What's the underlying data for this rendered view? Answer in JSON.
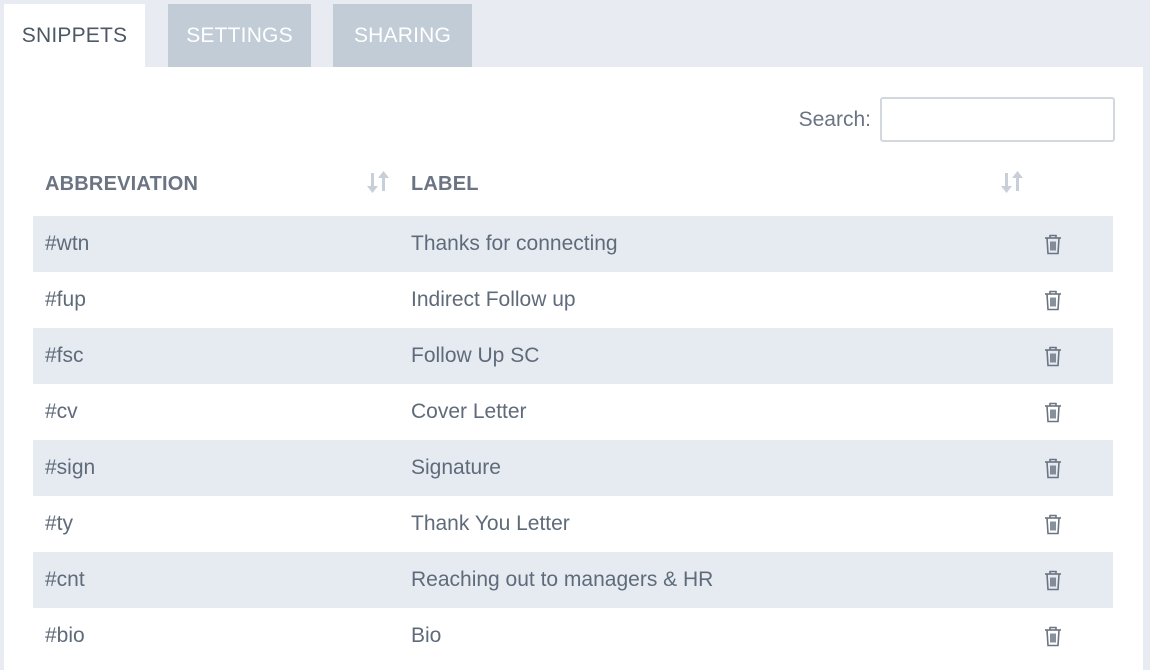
{
  "tabs": [
    {
      "label": "SNIPPETS",
      "active": true
    },
    {
      "label": "SETTINGS",
      "active": false
    },
    {
      "label": "SHARING",
      "active": false
    }
  ],
  "search": {
    "label": "Search:",
    "value": "",
    "placeholder": ""
  },
  "table": {
    "columns": [
      "ABBREVIATION",
      "LABEL"
    ],
    "sort_icon": "sort-arrows-icon",
    "delete_icon": "trash-icon",
    "rows": [
      {
        "abbreviation": "#wtn",
        "label": "Thanks for connecting"
      },
      {
        "abbreviation": "#fup",
        "label": "Indirect Follow up"
      },
      {
        "abbreviation": "#fsc",
        "label": "Follow Up SC"
      },
      {
        "abbreviation": "#cv",
        "label": "Cover Letter"
      },
      {
        "abbreviation": "#sign",
        "label": "Signature"
      },
      {
        "abbreviation": "#ty",
        "label": "Thank You Letter"
      },
      {
        "abbreviation": "#cnt",
        "label": "Reaching out to managers & HR"
      },
      {
        "abbreviation": "#bio",
        "label": "Bio"
      }
    ]
  },
  "colors": {
    "background": "#e8ecf2",
    "tab_inactive": "#c2ccd7",
    "row_striped": "#e6ebf1",
    "text": "#5f6b7a"
  }
}
